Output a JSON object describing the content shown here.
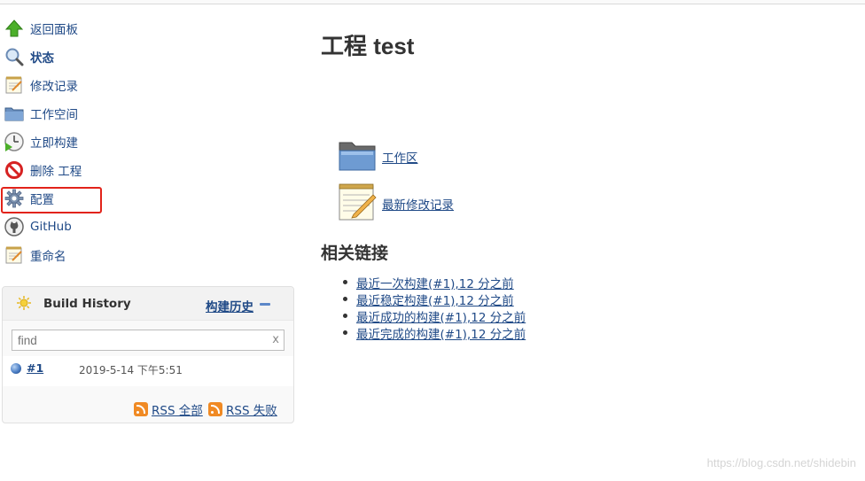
{
  "sidebar": {
    "items": [
      {
        "label": "返回面板",
        "icon": "up-arrow-icon"
      },
      {
        "label": "状态",
        "icon": "magnifier-icon"
      },
      {
        "label": "修改记录",
        "icon": "notepad-icon"
      },
      {
        "label": "工作空间",
        "icon": "folder-icon"
      },
      {
        "label": "立即构建",
        "icon": "clock-play-icon"
      },
      {
        "label": "删除 工程",
        "icon": "no-entry-icon"
      },
      {
        "label": "配置",
        "icon": "gear-icon"
      },
      {
        "label": "GitHub",
        "icon": "github-icon"
      },
      {
        "label": "重命名",
        "icon": "notepad-icon"
      }
    ]
  },
  "build_history": {
    "title": "Build History",
    "trend_link": "构建历史",
    "search_placeholder": "find",
    "clear_symbol": "x",
    "builds": [
      {
        "number": "#1",
        "date": "2019-5-14 下午5:51",
        "status_color": "#4a7dc4"
      }
    ],
    "rss_all": "RSS 全部",
    "rss_failed": "RSS 失败"
  },
  "main": {
    "title": "工程 test",
    "workspace_link": "工作区",
    "changes_link": "最新修改记录",
    "permalinks_heading": "相关链接",
    "permalinks": [
      "最近一次构建(#1),12 分之前",
      "最近稳定构建(#1),12 分之前",
      "最近成功的构建(#1),12 分之前",
      "最近完成的构建(#1),12 分之前"
    ]
  },
  "watermark": "https://blog.csdn.net/shidebin",
  "colors": {
    "link": "#204A87",
    "highlight": "#e2231a",
    "rss": "#f08a24"
  }
}
